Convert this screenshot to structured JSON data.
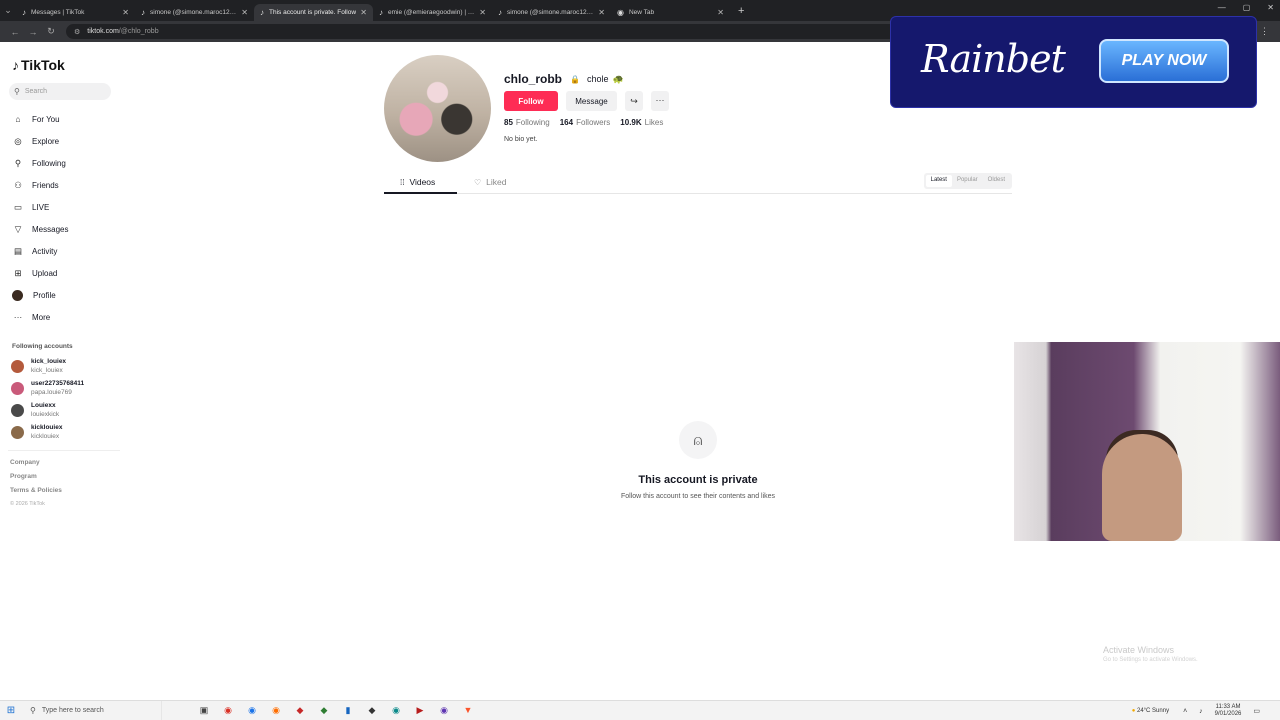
{
  "browser": {
    "tabs": [
      {
        "title": "Messages | TikTok",
        "active": false
      },
      {
        "title": "simone (@simone.maroc12) | Ti",
        "active": false
      },
      {
        "title": "This account is private. Follow",
        "active": true
      },
      {
        "title": "emie (@emieraegoodwin) | Tik",
        "active": false
      },
      {
        "title": "simone (@simone.maroc12) | Ti",
        "active": false
      },
      {
        "title": "New Tab",
        "active": false
      }
    ],
    "url_host": "tiktok.com",
    "url_path": "/@chlo_robb"
  },
  "sidebar": {
    "logo": "TikTok",
    "search_placeholder": "Search",
    "nav": [
      {
        "label": "For You",
        "icon": "home-icon",
        "glyph": "⌂"
      },
      {
        "label": "Explore",
        "icon": "compass-icon",
        "glyph": "◎"
      },
      {
        "label": "Following",
        "icon": "following-icon",
        "glyph": "⚲"
      },
      {
        "label": "Friends",
        "icon": "friends-icon",
        "glyph": "⚇"
      },
      {
        "label": "LIVE",
        "icon": "live-icon",
        "glyph": "▭"
      },
      {
        "label": "Messages",
        "icon": "messages-icon",
        "glyph": "▽"
      },
      {
        "label": "Activity",
        "icon": "activity-icon",
        "glyph": "▤"
      },
      {
        "label": "Upload",
        "icon": "upload-icon",
        "glyph": "⊞"
      },
      {
        "label": "Profile",
        "icon": "profile-icon",
        "glyph": ""
      },
      {
        "label": "More",
        "icon": "more-icon",
        "glyph": "···"
      }
    ],
    "following_title": "Following accounts",
    "following": [
      {
        "user": "kick_louiex",
        "name": "kick_louiex",
        "color": "#b45a3c"
      },
      {
        "user": "user22735768411",
        "name": "papa.louie769",
        "color": "#c95a7a"
      },
      {
        "user": "Louiexx",
        "name": "louiexkick",
        "color": "#4a4a4a"
      },
      {
        "user": "kicklouiex",
        "name": "kicklouiex",
        "color": "#8a6a4a"
      }
    ],
    "footer": [
      "Company",
      "Program",
      "Terms & Policies"
    ],
    "copyright": "© 2026 TikTok"
  },
  "profile": {
    "username": "chlo_robb",
    "nickname": "chole",
    "emoji": "🐢",
    "follow_label": "Follow",
    "message_label": "Message",
    "following_count": "85",
    "following_label": "Following",
    "followers_count": "164",
    "followers_label": "Followers",
    "likes_count": "10.9K",
    "likes_label": "Likes",
    "bio": "No bio yet."
  },
  "content_tabs": {
    "videos": "Videos",
    "liked": "Liked",
    "sort": [
      "Latest",
      "Popular",
      "Oldest"
    ]
  },
  "private": {
    "title": "This account is private",
    "subtitle": "Follow this account to see their contents and likes"
  },
  "ad": {
    "brand": "Rainbet",
    "cta": "PLAY NOW",
    "bg": "#15186d"
  },
  "watermark": {
    "line1": "Activate Windows",
    "line2": "Go to Settings to activate Windows."
  },
  "taskbar": {
    "search_placeholder": "Type here to search",
    "weather": "24°C  Sunny",
    "time": "11:33 AM",
    "date": "9/01/2026"
  },
  "colors": {
    "accent": "#fe2c55"
  }
}
